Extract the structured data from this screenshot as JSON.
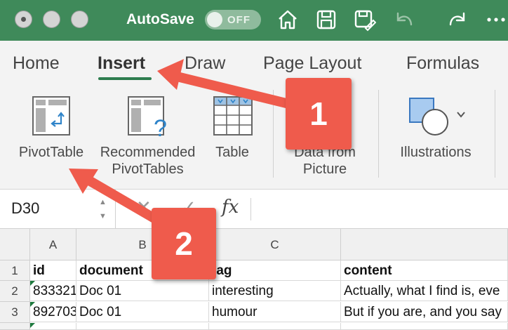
{
  "titlebar": {
    "autosave_label": "AutoSave",
    "autosave_state": "OFF",
    "bg_color": "#3f8a5a",
    "icons": [
      "home-icon",
      "save-icon",
      "save-as-icon",
      "undo-icon",
      "redo-icon",
      "more-icon"
    ]
  },
  "ribbon": {
    "tabs": [
      "Home",
      "Insert",
      "Draw",
      "Page Layout",
      "Formulas"
    ],
    "active_tab": "Insert",
    "buttons": {
      "pivottable": "PivotTable",
      "recommended_line1": "Recommended",
      "recommended_line2": "PivotTables",
      "table": "Table",
      "data_from_line1": "Data from",
      "data_from_line2": "Picture",
      "illustrations": "Illustrations"
    }
  },
  "formula_bar": {
    "name_box": "D30",
    "fx_label": "fx",
    "cancel_symbol": "✕",
    "enter_symbol": "✓"
  },
  "grid": {
    "columns": [
      "A",
      "B",
      "C"
    ],
    "rows": [
      {
        "num": "1",
        "cells": [
          "id",
          "document",
          "tag",
          "content"
        ]
      },
      {
        "num": "2",
        "cells": [
          "833321",
          "Doc 01",
          "interesting",
          "Actually, what I find is, eve"
        ]
      },
      {
        "num": "3",
        "cells": [
          "892703",
          "Doc 01",
          "humour",
          "But if you are, and you say"
        ]
      },
      {
        "num": "4",
        "cells": [
          "",
          "",
          "",
          ""
        ]
      }
    ]
  },
  "annotations": {
    "callout_1": "1",
    "callout_2": "2",
    "color": "#ef5b4c"
  }
}
